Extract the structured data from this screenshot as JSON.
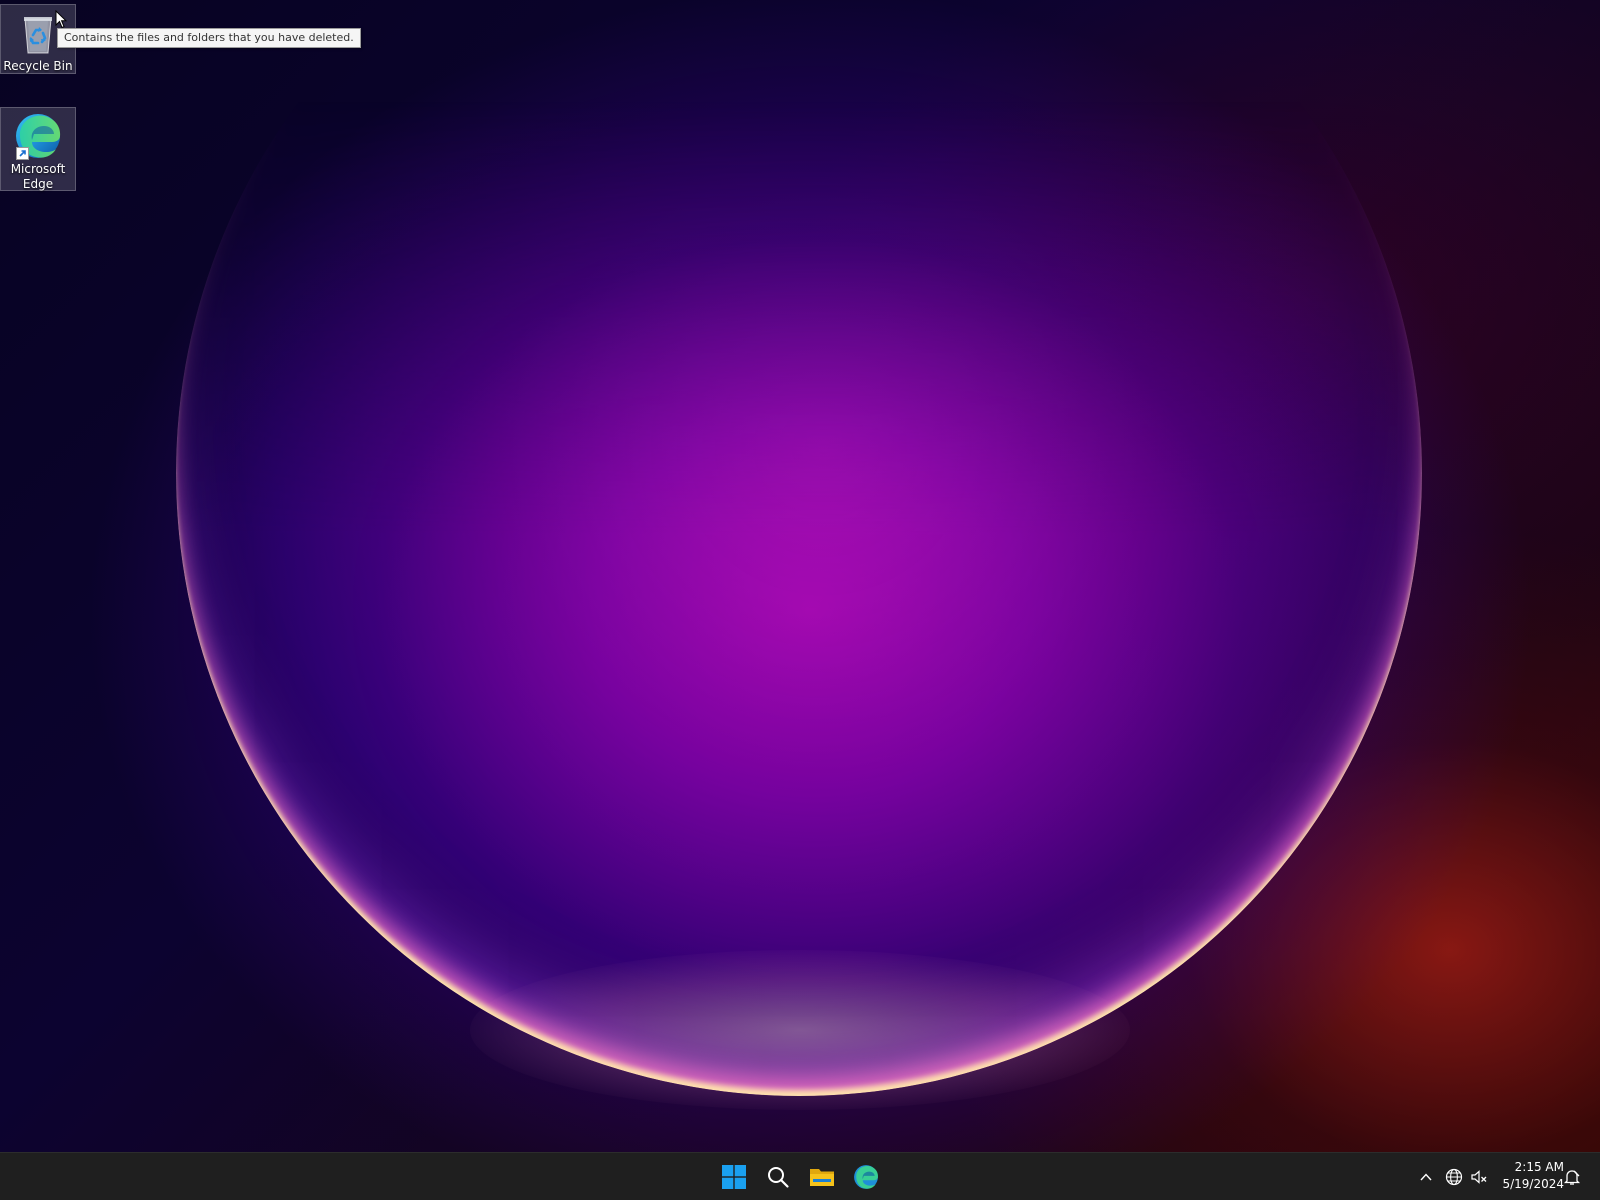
{
  "desktop": {
    "icons": [
      {
        "label": "Recycle Bin",
        "icon": "recycle-bin-icon"
      },
      {
        "label": "Microsoft Edge",
        "icon": "edge-icon",
        "shortcut": true
      }
    ],
    "tooltip": "Contains the files and folders that you have deleted."
  },
  "taskbar": {
    "pinned": [
      {
        "name": "start",
        "icon": "windows-logo-icon"
      },
      {
        "name": "search",
        "icon": "search-icon"
      },
      {
        "name": "file-explorer",
        "icon": "folder-icon"
      },
      {
        "name": "edge",
        "icon": "edge-icon"
      }
    ],
    "tray": {
      "icons": [
        "chevron-up-icon",
        "network-globe-icon",
        "volume-muted-icon",
        "notification-bell-icon"
      ],
      "time": "2:15 AM",
      "date": "5/19/2024"
    }
  },
  "colors": {
    "taskbar": "#1f1f1f",
    "windows_blue": "#1aa0f0",
    "folder_yellow": "#f5c21b"
  }
}
